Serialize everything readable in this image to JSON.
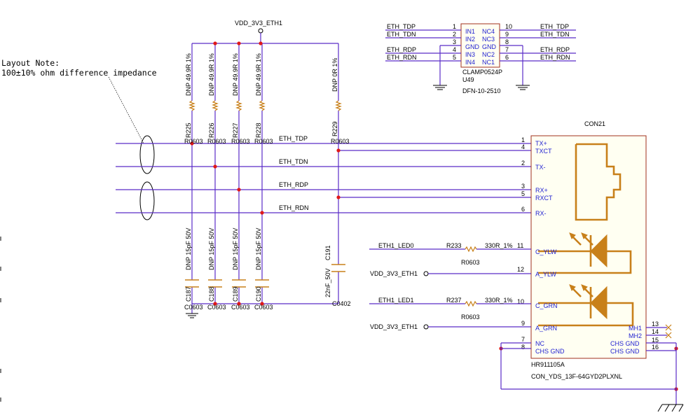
{
  "layout_note": {
    "line1": "Layout Note:",
    "line2": "100±10% ohm difference impedance"
  },
  "power": {
    "vdd_top": "VDD_3V3_ETH1"
  },
  "nets": {
    "tdp": "ETH_TDP",
    "tdn": "ETH_TDN",
    "rdp": "ETH_RDP",
    "rdn": "ETH_RDN",
    "led0": "ETH1_LED0",
    "led1": "ETH1_LED1",
    "vdd_led1": "VDD_3V3_ETH1",
    "vdd_led2": "VDD_3V3_ETH1"
  },
  "resistors": [
    {
      "value": "DNP 49.9R 1%",
      "ref": "R225",
      "pkg": "R0603"
    },
    {
      "value": "DNP 49.9R 1%",
      "ref": "R226",
      "pkg": "R0603"
    },
    {
      "value": "DNP 49.9R 1%",
      "ref": "R227",
      "pkg": "R0603"
    },
    {
      "value": "DNP 49.9R 1%",
      "ref": "R228",
      "pkg": "R0603"
    },
    {
      "value": "DNP 0R 1%",
      "ref": "R229",
      "pkg": "R0603"
    }
  ],
  "capacitors": [
    {
      "value": "DNP 15pF 50V",
      "ref": "C187",
      "pkg": "C0603"
    },
    {
      "value": "DNP 15pF 50V",
      "ref": "C188",
      "pkg": "C0603"
    },
    {
      "value": "DNP 15pF 50V",
      "ref": "C189",
      "pkg": "C0603"
    },
    {
      "value": "DNP 15pF 50V",
      "ref": "C190",
      "pkg": "C0603"
    },
    {
      "value": "22nF_50V",
      "ref": "C191",
      "pkg": "C0402"
    }
  ],
  "u49": {
    "part": "CLAMP0524P",
    "ref": "U49",
    "pkg": "DFN-10-2510",
    "left_pins": [
      {
        "num": "1",
        "name": "IN1",
        "net": "ETH_TDP"
      },
      {
        "num": "2",
        "name": "IN2",
        "net": "ETH_TDN"
      },
      {
        "num": "3",
        "name": "GND",
        "net": ""
      },
      {
        "num": "4",
        "name": "IN3",
        "net": "ETH_RDP"
      },
      {
        "num": "5",
        "name": "IN4",
        "net": "ETH_RDN"
      }
    ],
    "right_pins": [
      {
        "num": "10",
        "name": "NC4",
        "net": "ETH_TDP"
      },
      {
        "num": "9",
        "name": "NC3",
        "net": "ETH_TDN"
      },
      {
        "num": "8",
        "name": "GND",
        "net": ""
      },
      {
        "num": "7",
        "name": "NC2",
        "net": "ETH_RDP"
      },
      {
        "num": "6",
        "name": "NC1",
        "net": "ETH_RDN"
      }
    ]
  },
  "con21": {
    "ref": "CON21",
    "part": "HR911105A",
    "desc": "CON_YDS_13F-64GYD2PLXNL",
    "left_pins": [
      {
        "num": "1",
        "name": "TX+"
      },
      {
        "num": "4",
        "name": "TXCT"
      },
      {
        "num": "2",
        "name": "TX-"
      },
      {
        "num": "3",
        "name": "RX+"
      },
      {
        "num": "5",
        "name": "RXCT"
      },
      {
        "num": "6",
        "name": "RX-"
      },
      {
        "num": "11",
        "name": "C_YLW"
      },
      {
        "num": "12",
        "name": "A_YLW"
      },
      {
        "num": "10",
        "name": "C_GRN"
      },
      {
        "num": "9",
        "name": "A_GRN"
      },
      {
        "num": "7",
        "name": "NC"
      },
      {
        "num": "8",
        "name": "CHS GND"
      }
    ],
    "right_pins": [
      {
        "num": "13",
        "name": "MH1"
      },
      {
        "num": "14",
        "name": "MH2"
      },
      {
        "num": "15",
        "name": "CHS GND"
      },
      {
        "num": "16",
        "name": "CHS GND"
      }
    ]
  },
  "led_resistors": [
    {
      "ref": "R233",
      "value": "330R_1%",
      "pkg": "R0603"
    },
    {
      "ref": "R237",
      "value": "330R_1%",
      "pkg": "R0603"
    }
  ],
  "colors": {
    "wire": "#5a2cc8",
    "junction": "#e01818",
    "pin_text": "#1f1fd0",
    "component": "#c8801a",
    "box_border": "#a0301e"
  }
}
